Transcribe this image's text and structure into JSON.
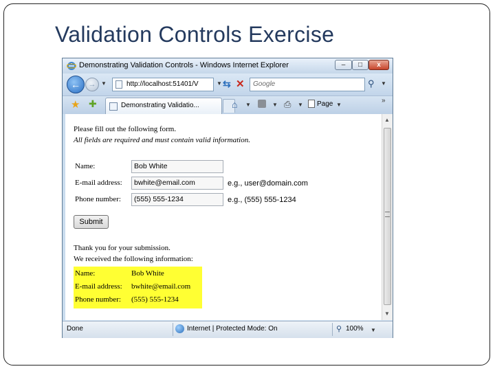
{
  "slide": {
    "title": "Validation Controls Exercise"
  },
  "browser": {
    "window_title": "Demonstrating Validation Controls - Windows Internet Explorer",
    "window_buttons": {
      "minimize": "–",
      "maximize": "□",
      "close": "x"
    },
    "address_url": "http://localhost:51401/V",
    "search_placeholder": "Google",
    "tab_title": "Demonstrating Validatio...",
    "page_menu_label": "Page",
    "status": {
      "text": "Done",
      "zone": "Internet | Protected Mode: On",
      "zoom": "100%"
    }
  },
  "form": {
    "intro_line1": "Please fill out the following form.",
    "intro_line2": "All fields are required and must contain valid information.",
    "fields": [
      {
        "label": "Name:",
        "value": "Bob White",
        "hint": ""
      },
      {
        "label": "E-mail address:",
        "value": "bwhite@email.com",
        "hint": "e.g., user@domain.com"
      },
      {
        "label": "Phone number:",
        "value": "(555) 555-1234",
        "hint": "e.g., (555) 555-1234"
      }
    ],
    "submit_label": "Submit"
  },
  "result": {
    "thanks_line1": "Thank you for your submission.",
    "thanks_line2": "We received the following information:",
    "rows": [
      {
        "label": "Name:",
        "value": "Bob White"
      },
      {
        "label": "E-mail address:",
        "value": "bwhite@email.com"
      },
      {
        "label": "Phone number:",
        "value": "(555) 555-1234"
      }
    ]
  },
  "colors": {
    "title": "#243a5e",
    "highlight": "#ffff33",
    "window_frame": "#c9dcee"
  }
}
